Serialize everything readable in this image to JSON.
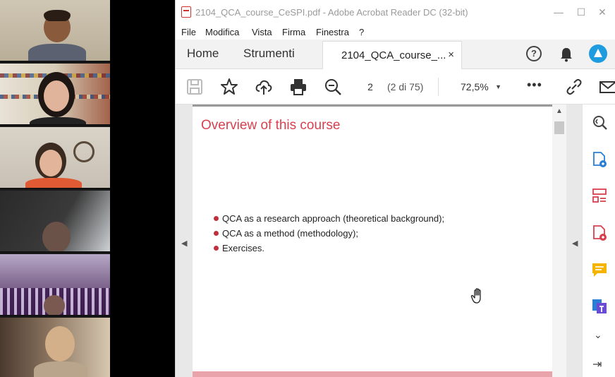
{
  "window": {
    "title": "2104_QCA_course_CeSPI.pdf - Adobe Acrobat Reader DC (32-bit)",
    "minimize": "—",
    "maximize": "☐",
    "close": "✕"
  },
  "menu": [
    "File",
    "Modifica",
    "Vista",
    "Firma",
    "Finestra",
    "?"
  ],
  "tabs": {
    "home": "Home",
    "tools": "Strumenti",
    "document": "2104_QCA_course_...",
    "close": "×"
  },
  "toolbar": {
    "page_number": "2",
    "page_of": "(2 di 75)",
    "zoom": "72,5%",
    "zoom_caret": "▼",
    "more": "•••"
  },
  "slide": {
    "title": "Overview of this course",
    "bullets": [
      "QCA as a research approach (theoretical background);",
      "QCA as a method (methodology);",
      "Exercises."
    ]
  },
  "nav": {
    "left": "◀",
    "right": "◀",
    "scroll_up": "▲"
  },
  "right_panel": {
    "chevron": "⌄",
    "exit": "⇥"
  },
  "colors": {
    "accent_red": "#d9404f",
    "bullet_red": "#c0303d",
    "acrobat_blue": "#1f9be0"
  }
}
